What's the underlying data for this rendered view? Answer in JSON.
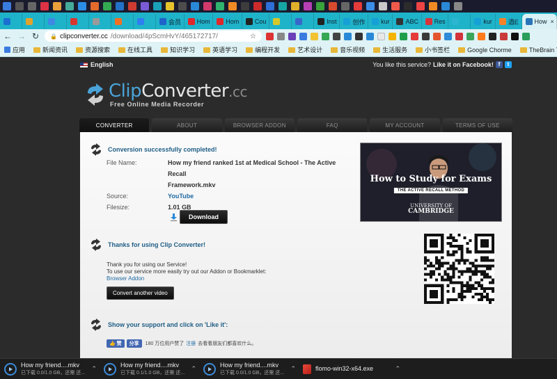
{
  "browser": {
    "tabs": [
      {
        "label": "",
        "color": "#1a6fd1"
      },
      {
        "label": "",
        "color": "#e2a32c"
      },
      {
        "label": "",
        "color": "#3e89e4"
      },
      {
        "label": "",
        "color": "#d9362f"
      },
      {
        "label": "",
        "color": "#9a9a9a"
      },
      {
        "label": "",
        "color": "#f36f21"
      },
      {
        "label": "",
        "color": "#2e7ff0"
      },
      {
        "label": "会员",
        "color": "#1e63c9"
      },
      {
        "label": "Hom",
        "color": "#e0272b"
      },
      {
        "label": "Hom",
        "color": "#e0272b"
      },
      {
        "label": "Cou",
        "color": "#222222"
      },
      {
        "label": "",
        "color": "#d7c82a"
      },
      {
        "label": "",
        "color": "#3966c9"
      },
      {
        "label": "Inst",
        "color": "#222222"
      },
      {
        "label": "创作",
        "color": "#15a0d6"
      },
      {
        "label": "kur",
        "color": "#15a0d6"
      },
      {
        "label": "ABC",
        "color": "#333333"
      },
      {
        "label": "Res",
        "color": "#d8333a"
      },
      {
        "label": "",
        "color": "#2cb5d0"
      },
      {
        "label": "kur",
        "color": "#15a0d6"
      },
      {
        "label": "酒E",
        "color": "#f5822a"
      },
      {
        "label": "How",
        "color": "#2a75b8",
        "active": true
      }
    ],
    "url_host": "clipconverter.cc",
    "url_path": "/download/4pScmHvY/465172717/",
    "bookmarks": [
      {
        "label": "应用"
      },
      {
        "label": "新闻资讯"
      },
      {
        "label": "资源搜索"
      },
      {
        "label": "在线工具"
      },
      {
        "label": "知识学习"
      },
      {
        "label": "英语学习"
      },
      {
        "label": "编程开发"
      },
      {
        "label": "艺术设计"
      },
      {
        "label": "音乐视频"
      },
      {
        "label": "生活服务"
      },
      {
        "label": "小书签栏"
      },
      {
        "label": "Google Chorme"
      },
      {
        "label": "TheBrain Tutorials"
      }
    ]
  },
  "site": {
    "language": "English",
    "like_prompt": "You like this service?",
    "like_cta": "Like it on Facebook!",
    "logo_clip": "Clip",
    "logo_converter": "Converter",
    "logo_cc": ".cc",
    "logo_tagline": "Free Online Media Recorder",
    "nav": [
      "CONVERTER",
      "ABOUT",
      "BROWSER ADDON",
      "FAQ",
      "MY ACCOUNT",
      "TERMS OF USE"
    ]
  },
  "conversion": {
    "status": "Conversion successfully completed!",
    "file_name_label": "File Name:",
    "file_name_line1": "How my friend ranked 1st at Medical School - The Active Recall",
    "file_name_line2": "Framework.mkv",
    "source_label": "Source:",
    "source_value": "YouTube",
    "filesize_label": "Filesize:",
    "filesize_value": "1.01 GB",
    "download_label": "Download"
  },
  "thumbnail": {
    "title": "How to Study for Exams",
    "subtitle": "THE ACTIVE RECALL METHOD",
    "uni_line1": "UNIVERSITY OF",
    "uni_line2": "CAMBRIDGE"
  },
  "thanks": {
    "heading": "Thanks for using Clip Converter!",
    "line1": "Thank you for using our Service!",
    "line2": "To use our service more easily try out our Addon or Bookmarklet:",
    "link": "Browser Addon",
    "convert_another": "Convert another video"
  },
  "support": {
    "heading": "Show your support and click on 'Like it':",
    "like_btn": "赞",
    "share_btn": "分享",
    "count_text": "180 万位用户赞了",
    "register_link": "注册",
    "tail_text": "去看看朋友们都喜欢什么。"
  },
  "downloads": [
    {
      "name": "How my friend....mkv",
      "status": "已下载 0.0/1.0 GB，还需 还..."
    },
    {
      "name": "How my friend....mkv",
      "status": "已下载 0.1/1.0 GB，还需 还..."
    },
    {
      "name": "How my friend....mkv",
      "status": "已下载 0.0/1.0 GB，还需 还..."
    },
    {
      "name": "flomo-win32-x64.exe",
      "status": ""
    }
  ]
}
